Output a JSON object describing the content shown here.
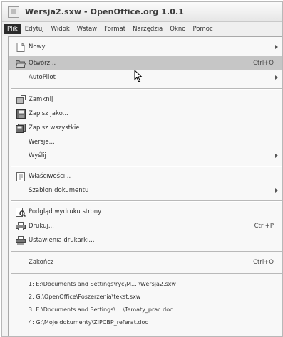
{
  "window": {
    "title": "Wersja2.sxw - OpenOffice.org 1.0.1"
  },
  "menubar": {
    "items": [
      "Plik",
      "Edytuj",
      "Widok",
      "Wstaw",
      "Format",
      "Narzędzia",
      "Okno",
      "Pomoc"
    ]
  },
  "file_menu": {
    "nowy": "Nowy",
    "otworz": "Otwórz...",
    "otworz_shortcut": "Ctrl+O",
    "autopilot": "AutoPilot",
    "zamknij": "Zamknij",
    "zapisz_jako": "Zapisz jako...",
    "zapisz_wszystkie": "Zapisz wszystkie",
    "wersje": "Wersje...",
    "wyslij": "Wyślij",
    "wlasciwosci": "Właściwości...",
    "szablon": "Szablon dokumentu",
    "podglad": "Podgląd wydruku strony",
    "drukuj": "Drukuj...",
    "drukuj_shortcut": "Ctrl+P",
    "ustawienia_drukarki": "Ustawienia drukarki...",
    "zakoncz": "Zakończ",
    "zakoncz_shortcut": "Ctrl+Q",
    "recent_files": [
      "1: E:\\Documents and Settings\\ryc\\M... \\Wersja2.sxw",
      "2: G:\\OpenOffice\\Poszerzenia\\tekst.sxw",
      "3: E:\\Documents and Settings\\... \\Tematy_prac.doc",
      "4: G:\\Moje dokumenty\\ZIPCBP_referat.doc"
    ]
  }
}
